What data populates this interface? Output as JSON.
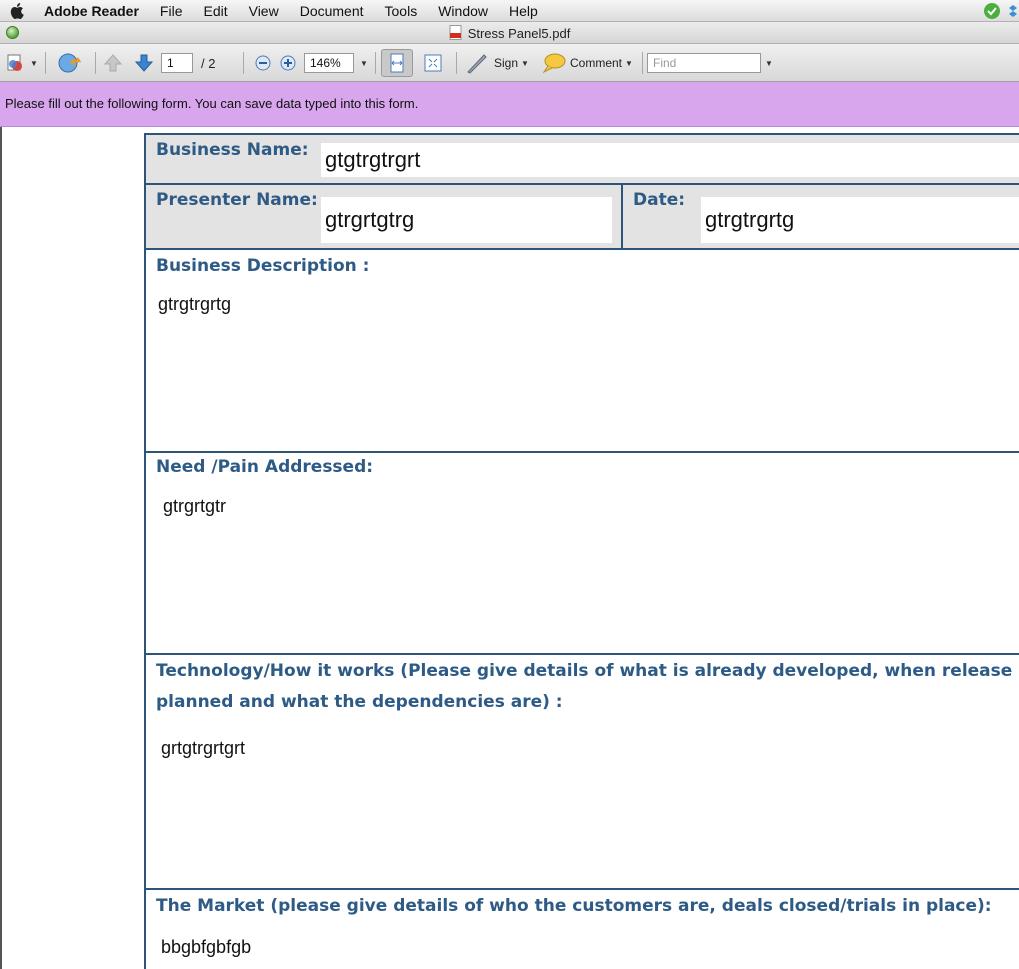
{
  "menubar": {
    "app_name": "Adobe Reader",
    "menus": [
      "File",
      "Edit",
      "View",
      "Document",
      "Tools",
      "Window",
      "Help"
    ]
  },
  "window": {
    "title": "Stress Panel5.pdf"
  },
  "toolbar": {
    "page_current": "1",
    "page_total": "/ 2",
    "zoom": "146%",
    "sign_label": "Sign",
    "comment_label": "Comment",
    "find_placeholder": "Find"
  },
  "notice": {
    "text": "Please fill out the following form. You can save data typed into this form."
  },
  "form": {
    "business_name": {
      "label": "Business Name:",
      "value": "gtgtrgtrgrt"
    },
    "presenter_name": {
      "label": "Presenter Name:",
      "value": "gtrgrtgtrg"
    },
    "date": {
      "label": "Date:",
      "value": "gtrgtrgrtg"
    },
    "business_description": {
      "label": "Business Description :",
      "value": "gtrgtrgrtg"
    },
    "need_pain": {
      "label": "Need /Pain Addressed:",
      "value": "gtrgrtgtr"
    },
    "technology": {
      "label_line1": "Technology/How it works (Please give details of what is already developed, when release is",
      "label_line2": "planned and what the dependencies are) :",
      "value": "grtgtrgrtgrt"
    },
    "market": {
      "label": "The Market (please give details of who the customers are,  deals closed/trials in place):",
      "value": "bbgbfgbfgb"
    }
  }
}
